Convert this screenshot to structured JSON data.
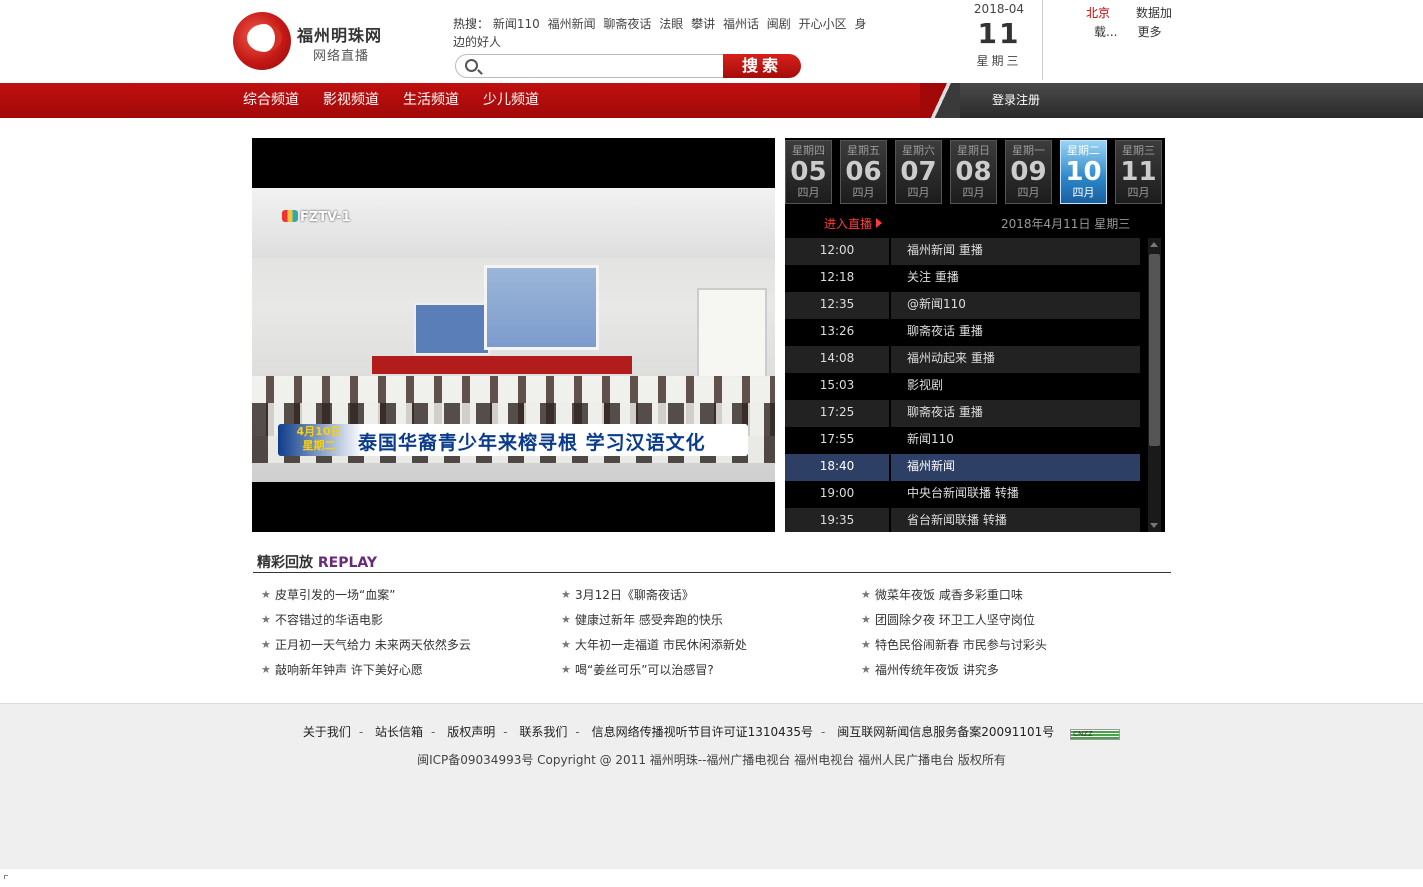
{
  "brand": {
    "title": "福州明珠网",
    "subtitle": "网络直播"
  },
  "hot": {
    "label": "热搜：",
    "links": [
      "新闻110",
      "福州新闻",
      "聊斋夜话",
      "法眼",
      "攀讲",
      "福州话",
      "闽剧",
      "开心小区",
      "身边的好人"
    ]
  },
  "search": {
    "placeholder": "",
    "value": "",
    "button": "搜索"
  },
  "date": {
    "year_month": "2018-04",
    "day": "11",
    "weekday": "星期三"
  },
  "weather": {
    "city": "北京",
    "status": "数据加载...",
    "status_a": "数据加",
    "status_b": "载...",
    "more": "更多"
  },
  "nav": {
    "items": [
      "综合频道",
      "影视频道",
      "生活频道",
      "少儿频道"
    ],
    "login": "登录注册"
  },
  "player": {
    "channel_logo": "FZTV-1",
    "caption_date": "4月10日",
    "caption_weekday": "星期二",
    "caption_text": "泰国华裔青少年来榕寻根  学习汉语文化"
  },
  "schedule": {
    "days": [
      {
        "week": "星期四",
        "num": "05",
        "month": "四月",
        "active": false
      },
      {
        "week": "星期五",
        "num": "06",
        "month": "四月",
        "active": false
      },
      {
        "week": "星期六",
        "num": "07",
        "month": "四月",
        "active": false
      },
      {
        "week": "星期日",
        "num": "08",
        "month": "四月",
        "active": false
      },
      {
        "week": "星期一",
        "num": "09",
        "month": "四月",
        "active": false
      },
      {
        "week": "星期二",
        "num": "10",
        "month": "四月",
        "active": true
      },
      {
        "week": "星期三",
        "num": "11",
        "month": "四月",
        "active": false
      }
    ],
    "enter_live": "进入直播",
    "current_date": "2018年4月11日 星期三",
    "programs": [
      {
        "time": "12:00",
        "name": "福州新闻 重播",
        "style": "alt"
      },
      {
        "time": "12:18",
        "name": "关注 重播",
        "style": ""
      },
      {
        "time": "12:35",
        "name": "@新闻110",
        "style": "alt"
      },
      {
        "time": "13:26",
        "name": "聊斋夜话 重播",
        "style": ""
      },
      {
        "time": "14:08",
        "name": "福州动起来 重播",
        "style": "alt"
      },
      {
        "time": "15:03",
        "name": "影视剧",
        "style": ""
      },
      {
        "time": "17:25",
        "name": "聊斋夜话 重播",
        "style": "alt"
      },
      {
        "time": "17:55",
        "name": "新闻110",
        "style": ""
      },
      {
        "time": "18:40",
        "name": "福州新闻",
        "style": "cur"
      },
      {
        "time": "19:00",
        "name": "中央台新闻联播 转播",
        "style": ""
      },
      {
        "time": "19:35",
        "name": "省台新闻联播 转播",
        "style": "alt"
      }
    ]
  },
  "replay": {
    "title_cn": "精彩回放",
    "title_en": "REPLAY",
    "columns": [
      [
        "皮草引发的一场“血案”",
        "不容错过的华语电影",
        "正月初一天气给力 未来两天依然多云",
        "敲响新年钟声 许下美好心愿"
      ],
      [
        "3月12日《聊斋夜话》",
        "健康过新年 感受奔跑的快乐",
        "大年初一走福道 市民休闲添新处",
        "喝“姜丝可乐”可以治感冒?"
      ],
      [
        "微菜年夜饭 咸香多彩重口味",
        "团圆除夕夜 环卫工人坚守岗位",
        "特色民俗闹新春 市民参与讨彩头",
        "福州传统年夜饭 讲究多"
      ]
    ]
  },
  "footer": {
    "links": [
      "关于我们",
      "站长信箱",
      "版权声明",
      "联系我们",
      "信息网络传播视听节目许可证1310435号",
      "闽互联网新闻信息服务备案20091101号"
    ],
    "badge": "CNZZ",
    "copyright": "闽ICP备09034993号  Copyright @ 2011 福州明珠--福州广播电视台 福州电视台 福州人民广播电台 版权所有"
  },
  "colors": {
    "brand_red": "#c01010",
    "nav_dark": "#2b2b2b",
    "active_day": "#2b87c8",
    "current_row": "#2e3f66",
    "live_red": "#ff3a3a"
  }
}
